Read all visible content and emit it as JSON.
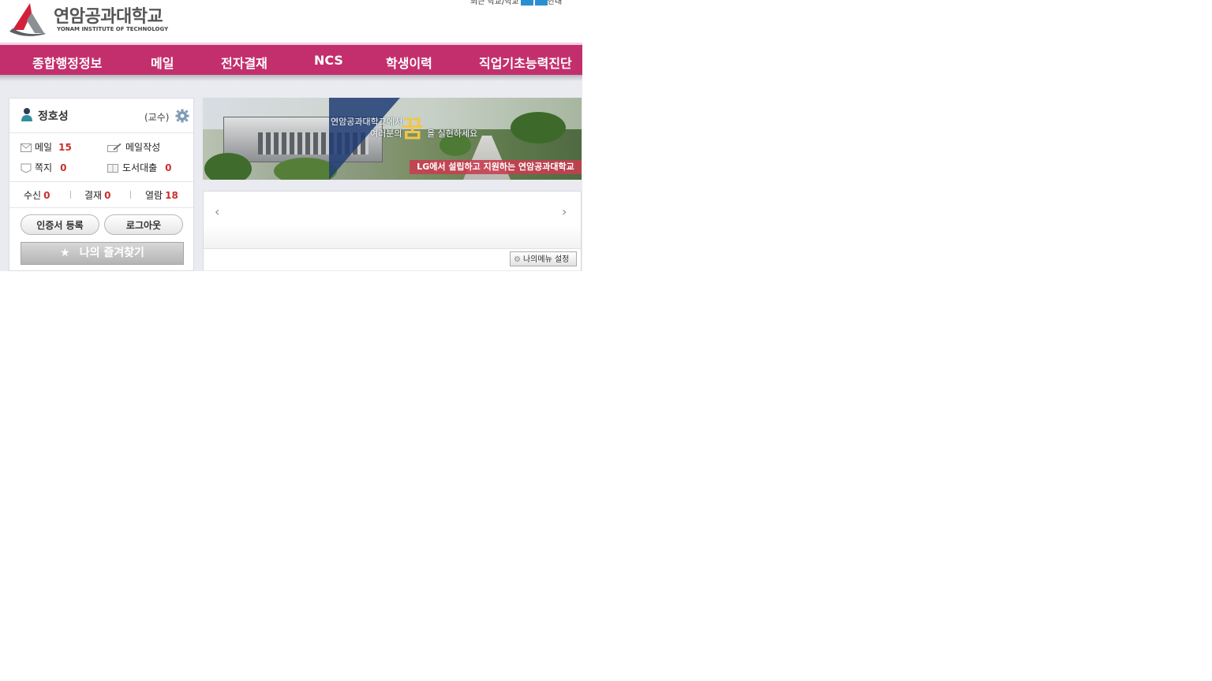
{
  "header": {
    "logo_ko": "연암공과대학교",
    "logo_en": "YONAM INSTITUTE OF TECHNOLOGY",
    "toplinks_text": "최근 학교/학교",
    "toplinks_tail": "안내"
  },
  "gnb": {
    "items": [
      "종합행정정보",
      "메일",
      "전자결재",
      "NCS",
      "학생이력",
      "직업기초능력진단"
    ]
  },
  "user": {
    "name": "정호성",
    "role": "(교수)",
    "stats": [
      {
        "label": "메일",
        "count": "15"
      },
      {
        "label": "메일작성",
        "count": ""
      },
      {
        "label": "쪽지",
        "count": "0"
      },
      {
        "label": "도서대출",
        "count": "0"
      }
    ],
    "row2": [
      {
        "label": "수신",
        "count": "0"
      },
      {
        "label": "결재",
        "count": "0"
      },
      {
        "label": "열람",
        "count": "18"
      }
    ],
    "cert_button": "인증서 등록",
    "logout_button": "로그아웃",
    "favorites_button": "나의 즐겨찾기"
  },
  "banner": {
    "line1": "연암공과대학교에서",
    "line2": "여러분의",
    "big_char": "꿈",
    "line3": "을 실현하세요",
    "footer": "LG에서 설립하고 지원하는 연암공과대학교"
  },
  "mymenu": {
    "prev_icon": "‹",
    "next_icon": "›",
    "settings_button": "나의메뉴 설정"
  },
  "colors": {
    "gnb": "#c32f6d",
    "accent_number": "#c8302c",
    "banner_footer": "#c83c50"
  },
  "icons": [
    "logo-mark-icon",
    "person-icon",
    "gear-icon",
    "mail-icon",
    "mail-write-icon",
    "note-icon",
    "book-icon",
    "star-icon",
    "chevron-left-icon",
    "chevron-right-icon"
  ]
}
